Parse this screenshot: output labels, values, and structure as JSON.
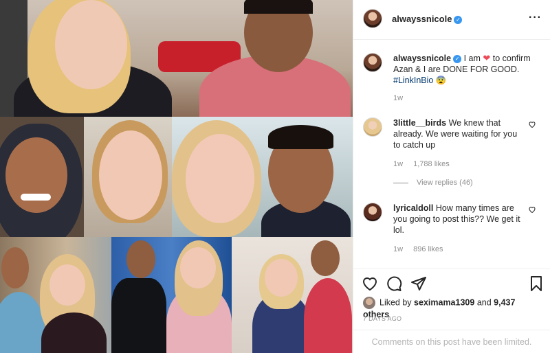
{
  "post": {
    "username": "alwayssnicole",
    "more_icon": "more-icon",
    "caption_prefix": "I am",
    "caption_suffix": "to confirm Azan & I are DONE FOR GOOD.",
    "caption_hashtag": "#LinkInBio",
    "caption_emoji": "😨",
    "caption_time": "1w"
  },
  "comments": [
    {
      "username": "3little__birds",
      "text": "We knew that already. We were waiting for you to catch up",
      "time": "1w",
      "likes": "1,788 likes",
      "view_replies": "View replies (46)"
    },
    {
      "username": "lyricaldoll",
      "text": "How many times are you going to post this?? We get it lol.",
      "time": "1w",
      "likes": "896 likes"
    }
  ],
  "actions": {
    "liked_prefix": "Liked by",
    "liked_user": "seximama1309",
    "liked_and": "and",
    "liked_count": "9,437 others",
    "date": "7 DAYS AGO",
    "comments_limited": "Comments on this post have been limited."
  },
  "colors": {
    "verified": "#3897f0",
    "heart": "#ed4956",
    "muted": "#8e8e8e"
  }
}
